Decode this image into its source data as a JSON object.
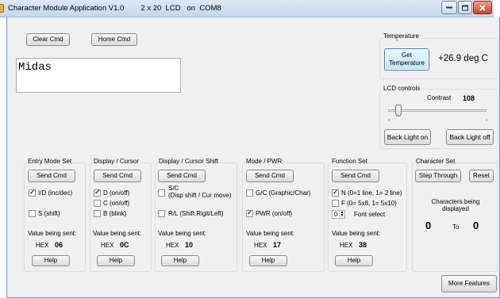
{
  "window": {
    "title": "Character Module Application V1.0        2 x 20  LCD   on  COM8",
    "minimize_icon": "minimize-icon",
    "maximize_icon": "maximize-icon",
    "close_icon": "close-icon"
  },
  "top_buttons": {
    "clear": "Clear Cmd",
    "home": "Home Cmd"
  },
  "lcd_display": {
    "text": "Midas"
  },
  "temperature": {
    "caption": "Temperature",
    "button": "Get Temperature",
    "value": "+26.9 deg C"
  },
  "lcd_controls": {
    "caption": "LCD controls",
    "contrast_label": "Contrast",
    "contrast_value": "108",
    "backlight_on": "Back Light on",
    "backlight_off": "Back Light off"
  },
  "entry_mode": {
    "caption": "Entry Mode Set",
    "send": "Send Cmd",
    "opt1": {
      "label": "I/D (inc/dec)",
      "checked": true
    },
    "opt2": {
      "label": "S (shift)",
      "checked": false
    },
    "value_label": "Value being sent:",
    "hex_label": "HEX",
    "hex_value": "06",
    "help": "Help"
  },
  "display_cursor": {
    "caption": "Display / Cursor",
    "send": "Send Cmd",
    "opt1": {
      "label": "D (on/off)",
      "checked": true
    },
    "opt2": {
      "label": "C (on/off)",
      "checked": false
    },
    "opt3": {
      "label": "B (blink)",
      "checked": false
    },
    "value_label": "Value being sent:",
    "hex_label": "HEX",
    "hex_value": "0C",
    "help": "Help"
  },
  "display_shift": {
    "caption": "Display / Cursor Shift",
    "send": "Send Cmd",
    "opt1": {
      "label_l1": "S/C",
      "label_l2": "(Disp shift / Cur move)",
      "checked": false
    },
    "opt2": {
      "label": "R/L (Shift Rigit/Left)",
      "checked": false
    },
    "value_label": "Value being sent:",
    "hex_label": "HEX",
    "hex_value": "10",
    "help": "Help"
  },
  "mode_pwr": {
    "caption": "Mode / PWR",
    "send": "Send Cmd",
    "opt1": {
      "label": "G/C (Graphic/Char)",
      "checked": false
    },
    "opt2": {
      "label": "PWR (on/off)",
      "checked": true
    },
    "value_label": "Value being sent:",
    "hex_label": "HEX",
    "hex_value": "17",
    "help": "Help"
  },
  "function_set": {
    "caption": "Function Set",
    "send": "Send Cmd",
    "opt1": {
      "label": "N (0=1 line, 1= 2 line)",
      "checked": true
    },
    "opt2": {
      "label": "F (0= 5x8, 1= 5x10)",
      "checked": false
    },
    "font_select_value": "0",
    "font_select_label": "Font select",
    "value_label": "Value being sent:",
    "hex_label": "HEX",
    "hex_value": "38",
    "help": "Help"
  },
  "character_set": {
    "caption": "Character Set",
    "step": "Step Through",
    "reset": "Reset",
    "info": "Characters being displayed",
    "from": "0",
    "to_label": "To",
    "to": "0"
  },
  "more_features": "More Features"
}
